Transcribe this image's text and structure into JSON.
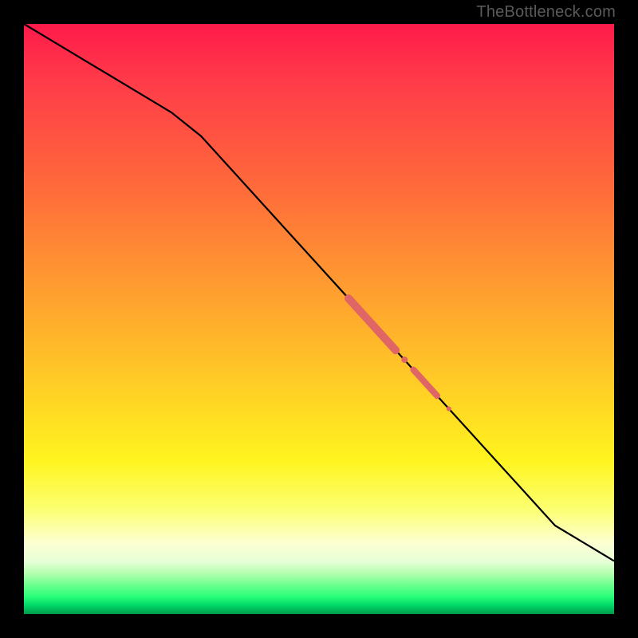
{
  "watermark": "TheBottleneck.com",
  "colors": {
    "frame": "#000000",
    "curve": "#000000",
    "marker": "#e06666"
  },
  "chart_data": {
    "type": "line",
    "title": "",
    "xlabel": "",
    "ylabel": "",
    "xlim": [
      0,
      100
    ],
    "ylim": [
      0,
      100
    ],
    "grid": false,
    "series": [
      {
        "name": "curve",
        "x": [
          0,
          5,
          10,
          15,
          20,
          25,
          30,
          35,
          40,
          45,
          50,
          55,
          60,
          65,
          70,
          75,
          80,
          85,
          90,
          95,
          100
        ],
        "y": [
          100,
          97,
          94,
          91,
          88,
          85,
          81,
          75.5,
          70,
          64.5,
          59,
          53.5,
          48,
          42.5,
          37,
          31.5,
          26,
          20.5,
          15,
          12,
          9
        ]
      }
    ],
    "markers": [
      {
        "name": "thick-segment",
        "x": [
          55,
          63
        ],
        "y": [
          53.5,
          44.7
        ],
        "weight": 10
      },
      {
        "name": "dot-1",
        "x": [
          64.5
        ],
        "y": [
          43.1
        ],
        "weight": 8
      },
      {
        "name": "short-segment",
        "x": [
          66,
          70
        ],
        "y": [
          41.4,
          37.0
        ],
        "weight": 8
      },
      {
        "name": "dot-2",
        "x": [
          72
        ],
        "y": [
          34.8
        ],
        "weight": 6
      }
    ]
  }
}
